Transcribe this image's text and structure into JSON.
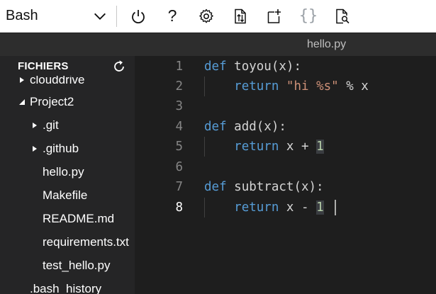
{
  "toolbar": {
    "shell": "Bash",
    "buttons": [
      {
        "icon": "power-icon"
      },
      {
        "icon": "help-icon",
        "glyph": "?"
      },
      {
        "icon": "gear-icon"
      },
      {
        "icon": "upload-download-file-icon"
      },
      {
        "icon": "new-file-icon"
      },
      {
        "icon": "braces-icon",
        "glyph": "{}"
      },
      {
        "icon": "file-search-icon"
      }
    ]
  },
  "tab": {
    "label": "hello.py"
  },
  "sidebar": {
    "title": "FICHIERS",
    "items": [
      {
        "label": "clouddrive",
        "expanded": false,
        "indent": 0
      },
      {
        "label": "Project2",
        "expanded": true,
        "indent": 0
      },
      {
        "label": ".git",
        "expanded": false,
        "indent": 1
      },
      {
        "label": ".github",
        "expanded": false,
        "indent": 1
      },
      {
        "label": "hello.py",
        "indent": 1
      },
      {
        "label": "Makefile",
        "indent": 1
      },
      {
        "label": "README.md",
        "indent": 1
      },
      {
        "label": "requirements.txt",
        "indent": 1
      },
      {
        "label": "test_hello.py",
        "indent": 1
      },
      {
        "label": ".bash_history",
        "indent": 0
      }
    ]
  },
  "editor": {
    "active_line": 8,
    "lines": [
      {
        "number": "1",
        "text": "def toyou(x):"
      },
      {
        "number": "2",
        "text": "    return \"hi %s\" % x"
      },
      {
        "number": "3",
        "text": ""
      },
      {
        "number": "4",
        "text": "def add(x):"
      },
      {
        "number": "5",
        "text": "    return x + 1"
      },
      {
        "number": "6",
        "text": ""
      },
      {
        "number": "7",
        "text": "def subtract(x):"
      },
      {
        "number": "8",
        "text": "    return x - 1"
      }
    ],
    "tokens": {
      "l1": {
        "kw": "def",
        "name": "toyou(x):"
      },
      "l2": {
        "kw": "return",
        "str": "\"hi %s\"",
        "rest": " % x"
      },
      "l4": {
        "kw": "def",
        "name": "add(x):"
      },
      "l5": {
        "kw": "return",
        "pre": " x + ",
        "num": "1"
      },
      "l7": {
        "kw": "def",
        "name": "subtract(x):"
      },
      "l8": {
        "kw": "return",
        "pre": " x - ",
        "num": "1"
      }
    }
  },
  "colors": {
    "keyword": "#569cd6",
    "string": "#ce9178",
    "number": "#b5cea8",
    "editor_bg": "#1e1e1e",
    "sidebar_bg": "#252526"
  }
}
